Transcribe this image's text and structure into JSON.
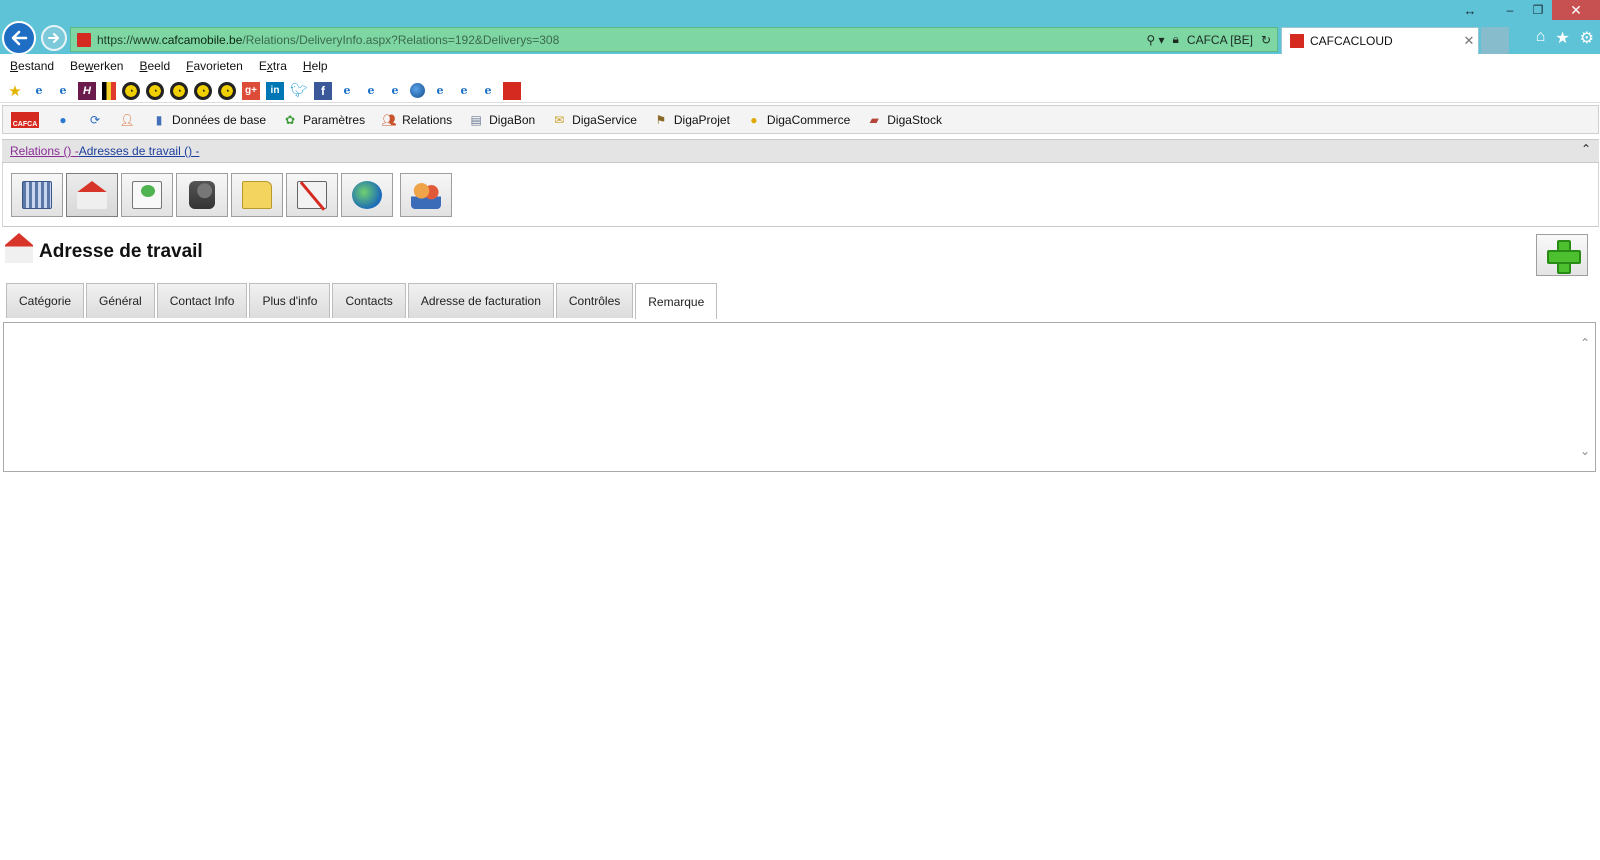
{
  "browser": {
    "url_scheme": "https://www.",
    "url_host": "cafcamobile.be",
    "url_path": "/Relations/DeliveryInfo.aspx?Relations=192&Deliverys=308",
    "cert_label": "CAFCA [BE]",
    "tab_title": "CAFCACLOUD"
  },
  "menu": {
    "items": [
      {
        "pre": "",
        "u": "B",
        "post": "estand"
      },
      {
        "pre": "Be",
        "u": "w",
        "post": "erken"
      },
      {
        "pre": "",
        "u": "B",
        "post": "eeld"
      },
      {
        "pre": "",
        "u": "F",
        "post": "avorieten"
      },
      {
        "pre": "E",
        "u": "x",
        "post": "tra"
      },
      {
        "pre": "",
        "u": "H",
        "post": "elp"
      }
    ]
  },
  "app_toolbar": {
    "items": [
      {
        "label": "Données de base",
        "icon": "database-icon"
      },
      {
        "label": "Paramètres",
        "icon": "settings-icon"
      },
      {
        "label": "Relations",
        "icon": "relations-icon"
      },
      {
        "label": "DigaBon",
        "icon": "digabon-icon"
      },
      {
        "label": "DigaService",
        "icon": "digaservice-icon"
      },
      {
        "label": "DigaProjet",
        "icon": "digaprojet-icon"
      },
      {
        "label": "DigaCommerce",
        "icon": "digacommerce-icon"
      },
      {
        "label": "DigaStock",
        "icon": "digastock-icon"
      }
    ]
  },
  "breadcrumb": {
    "first": "Relations () - ",
    "second": "Adresses de travail () -"
  },
  "section": {
    "title": "Adresse de travail"
  },
  "tabs": [
    {
      "label": "Catégorie",
      "active": false
    },
    {
      "label": "Général",
      "active": false
    },
    {
      "label": "Contact Info",
      "active": false
    },
    {
      "label": "Plus d'info",
      "active": false
    },
    {
      "label": "Contacts",
      "active": false
    },
    {
      "label": "Adresse de facturation",
      "active": false
    },
    {
      "label": "Contrôles",
      "active": false
    },
    {
      "label": "Remarque",
      "active": true
    }
  ],
  "remark": {
    "value": ""
  }
}
